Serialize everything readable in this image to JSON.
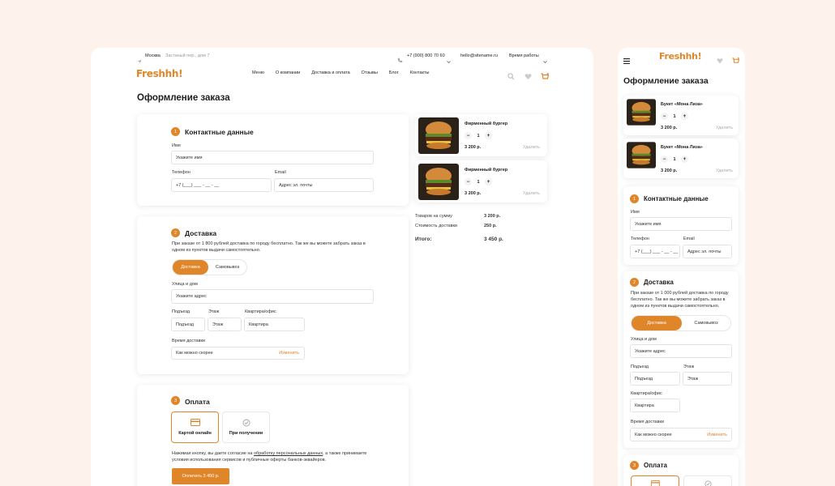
{
  "colors": {
    "accent": "#e0862a",
    "background": "#fdf3ec"
  },
  "topbar": {
    "city": "Москва",
    "address": "Застаный пер., дом 7",
    "phone": "+7 (900) 800 70 60",
    "email": "hello@sitename.ru",
    "hours": "Время работы"
  },
  "brand": {
    "logo": "Freshhh!"
  },
  "nav": [
    "Меню",
    "О компании",
    "Доставка и оплата",
    "Отзывы",
    "Блог",
    "Контакты"
  ],
  "page": {
    "title": "Оформление заказа"
  },
  "contacts": {
    "step": "1",
    "title": "Контактные данные",
    "name_label": "Имя",
    "name_placeholder": "Укажите имя",
    "phone_label": "Телефон",
    "phone_placeholder": "+7 (___) ___ - __ - __",
    "email_label": "Email",
    "email_placeholder": "Адрес эл. почты"
  },
  "delivery": {
    "step": "2",
    "title": "Доставка",
    "note": "При заказе от 1 800 рублей доставка по городу бесплатно. Так же вы можете забрать заказ в одном из пунктов выдачи самостоятельно.",
    "mobile_note": "При заказе от 1 000 рублей доставка по городу бесплатно. Так же вы можете забрать заказ в одном из пунктов выдачи самостоятельно.",
    "opt_delivery": "Доставка",
    "opt_pickup": "Самовывоз",
    "street_label": "Улица и дом",
    "street_placeholder": "Укажите адрес",
    "entrance_label": "Подъезд",
    "entrance_placeholder": "Подъезд",
    "floor_label": "Этаж",
    "floor_placeholder": "Этаж",
    "apt_label": "Квартира/офис",
    "apt_placeholder": "Квартира",
    "time_label": "Время доставки",
    "time_value": "Как можно скорее",
    "time_change": "Изменить"
  },
  "payment": {
    "step": "3",
    "title": "Оплата",
    "card_online": "Картой онлайн",
    "on_receipt": "При получении",
    "agree_pre": "Нажимая кнопку, вы даете согласие на ",
    "agree_link": "обработку персональных данных",
    "agree_post": ", а также принимаете условия использования сервисов и публичные оферты банков-эквайеров.",
    "pay_button": "Оплатить 3 450 р."
  },
  "cart": {
    "items": [
      {
        "name": "Фирменный бургер",
        "qty": "1",
        "price": "3 200 р.",
        "remove": "Удалить"
      },
      {
        "name": "Фирменный бургер",
        "qty": "1",
        "price": "3 200 р.",
        "remove": "Удалить"
      }
    ],
    "mobile_items": [
      {
        "name": "Букет «Мона Лиза»",
        "qty": "1",
        "price": "3 200 р.",
        "remove": "Удалить"
      },
      {
        "name": "Букет «Мона Лиза»",
        "qty": "1",
        "price": "3 200 р.",
        "remove": "Удалить"
      }
    ],
    "sum_label": "Товаров на сумму",
    "sum_value": "3 200 р.",
    "delivery_label": "Стоимость доставки",
    "delivery_value": "250 р.",
    "total_label": "Итого:",
    "total_value": "3 450 р.",
    "minus": "−",
    "plus": "+"
  }
}
